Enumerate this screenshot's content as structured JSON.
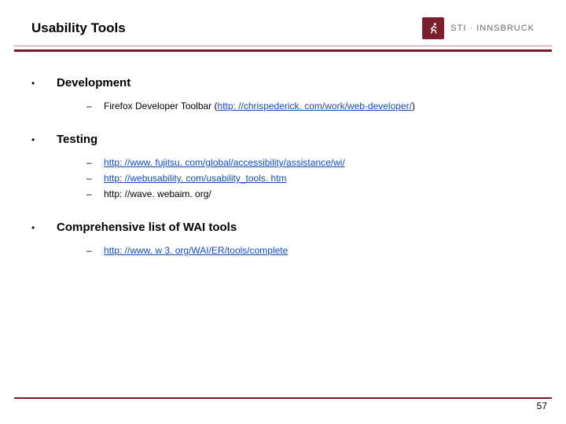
{
  "header": {
    "title": "Usability Tools",
    "logo": {
      "brand_left": "STI",
      "brand_right": "INNSBRUCK",
      "icon_name": "running-person-icon"
    }
  },
  "sections": [
    {
      "title": "Development",
      "items": [
        {
          "prefix": "Firefox Developer Toolbar (",
          "link": "http: //chrispederick. com/work/web-developer/",
          "suffix": ")"
        }
      ]
    },
    {
      "title": "Testing",
      "items": [
        {
          "link": "http: //www. fujitsu. com/global/accessibility/assistance/wi/"
        },
        {
          "link": "http: //webusability. com/usability_tools. htm"
        },
        {
          "plain": "http: //wave. webaim. org/"
        }
      ]
    },
    {
      "title": "Comprehensive list of WAI tools",
      "items": [
        {
          "link": "http: //www. w 3. org/WAI/ER/tools/complete"
        }
      ]
    }
  ],
  "footer": {
    "page_number": "57"
  },
  "colors": {
    "accent": "#7a1a28",
    "link": "#124bc4"
  }
}
